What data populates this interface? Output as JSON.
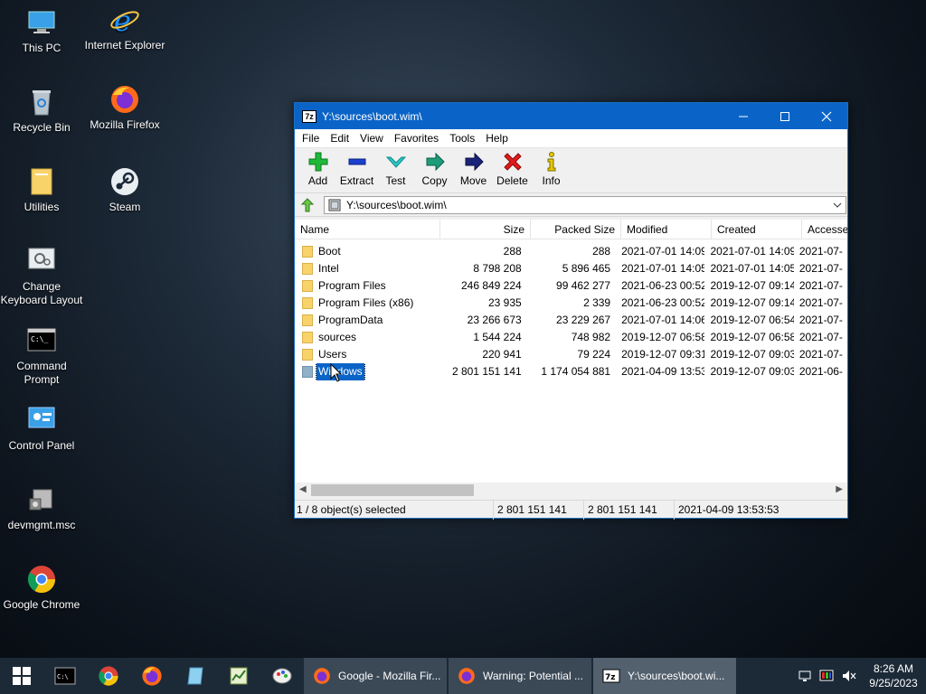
{
  "desktop": {
    "icons": [
      {
        "label": "This PC"
      },
      {
        "label": "Internet Explorer"
      },
      {
        "label": "Recycle Bin"
      },
      {
        "label": "Mozilla Firefox"
      },
      {
        "label": "Utilities"
      },
      {
        "label": "Steam"
      },
      {
        "label": "Change Keyboard Layout"
      },
      {
        "label": "Command Prompt"
      },
      {
        "label": "Control Panel"
      },
      {
        "label": "devmgmt.msc"
      },
      {
        "label": "Google Chrome"
      }
    ]
  },
  "window": {
    "title": "Y:\\sources\\boot.wim\\",
    "app_icon_text": "7z",
    "menu": [
      "File",
      "Edit",
      "View",
      "Favorites",
      "Tools",
      "Help"
    ],
    "toolbar": [
      "Add",
      "Extract",
      "Test",
      "Copy",
      "Move",
      "Delete",
      "Info"
    ],
    "address": "Y:\\sources\\boot.wim\\",
    "columns": [
      "Name",
      "Size",
      "Packed Size",
      "Modified",
      "Created",
      "Accesse"
    ],
    "rows": [
      {
        "name": "Boot",
        "size": "288",
        "packed": "288",
        "modified": "2021-07-01 14:09",
        "created": "2021-07-01 14:09",
        "accessed": "2021-07-"
      },
      {
        "name": "Intel",
        "size": "8 798 208",
        "packed": "5 896 465",
        "modified": "2021-07-01 14:05",
        "created": "2021-07-01 14:05",
        "accessed": "2021-07-"
      },
      {
        "name": "Program Files",
        "size": "246 849 224",
        "packed": "99 462 277",
        "modified": "2021-06-23 00:52",
        "created": "2019-12-07 09:14",
        "accessed": "2021-07-"
      },
      {
        "name": "Program Files (x86)",
        "size": "23 935",
        "packed": "2 339",
        "modified": "2021-06-23 00:52",
        "created": "2019-12-07 09:14",
        "accessed": "2021-07-"
      },
      {
        "name": "ProgramData",
        "size": "23 266 673",
        "packed": "23 229 267",
        "modified": "2021-07-01 14:06",
        "created": "2019-12-07 06:54",
        "accessed": "2021-07-"
      },
      {
        "name": "sources",
        "size": "1 544 224",
        "packed": "748 982",
        "modified": "2019-12-07 06:58",
        "created": "2019-12-07 06:58",
        "accessed": "2021-07-"
      },
      {
        "name": "Users",
        "size": "220 941",
        "packed": "79 224",
        "modified": "2019-12-07 09:31",
        "created": "2019-12-07 09:03",
        "accessed": "2021-07-"
      },
      {
        "name": "Windows",
        "size": "2 801 151 141",
        "packed": "1 174 054 881",
        "modified": "2021-04-09 13:53",
        "created": "2019-12-07 09:03",
        "accessed": "2021-06-"
      }
    ],
    "status": {
      "selection": "1 / 8 object(s) selected",
      "size": "2 801 151 141",
      "packed": "2 801 151 141",
      "date": "2021-04-09 13:53:53"
    }
  },
  "taskbar": {
    "tasks": [
      {
        "label": "Google - Mozilla Fir..."
      },
      {
        "label": "Warning: Potential ..."
      },
      {
        "label": "Y:\\sources\\boot.wi..."
      }
    ],
    "time": "8:26 AM",
    "date": "9/25/2023"
  },
  "colors": {
    "accent": "#0a64c8",
    "folder": "#f7d36a",
    "taskbar": "#1c2a38"
  }
}
